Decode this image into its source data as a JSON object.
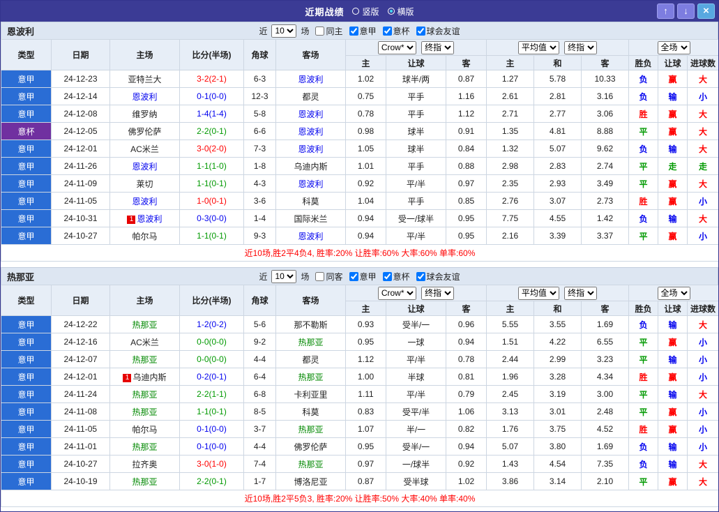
{
  "topbar": {
    "title": "近期战绩",
    "vertical_label": "竖版",
    "horizontal_label": "横版",
    "selected_mode": "横版",
    "up_icon": "↑",
    "down_icon": "↓",
    "close_icon": "×"
  },
  "colors": {
    "red": "#ff0000",
    "green": "#009900",
    "blue": "#0000ee",
    "league_blue": "#2a6dd5",
    "cup_purple": "#7030a0",
    "topbar_bg": "#3b3b95",
    "summary_red": "#ff0000"
  },
  "filters_shared": {
    "near_label": "近",
    "match_count": "10",
    "games_label": "场",
    "venue_checked": false,
    "league_options": [
      "意甲",
      "意杯",
      "球会友谊"
    ],
    "league_checked": [
      true,
      true,
      true
    ]
  },
  "table_head": {
    "type": "类型",
    "date": "日期",
    "home": "主场",
    "score": "比分(半场)",
    "corner": "角球",
    "away": "客场",
    "odds_select": "Crow*",
    "odds_ref_select": "终指",
    "avg_select": "平均值",
    "avg_ref_select": "终指",
    "fulltime_select": "全场",
    "sub_home": "主",
    "sub_handicap": "让球",
    "sub_away": "客",
    "sub_avg_home": "主",
    "sub_draw": "和",
    "sub_avg_away": "客",
    "sub_result": "胜负",
    "sub_hc_result": "让球",
    "sub_goals": "进球数"
  },
  "sections": [
    {
      "team": "恩波利",
      "team_color": "#0000ee",
      "venue_label": "同主",
      "summary": "近10场,胜2平4负4, 胜率:20% 让胜率:60% 大率:60% 单率:60%",
      "rows": [
        {
          "lg": "意甲",
          "d": "24-12-23",
          "h": "亚特兰大",
          "a": "恩波利",
          "af": true,
          "s": "3-2(2-1)",
          "sc": "r",
          "cn": "6-3",
          "o1": "1.02",
          "o2": "球半/两",
          "o3": "0.87",
          "v1": "1.27",
          "v2": "5.78",
          "v3": "10.33",
          "wl": "负",
          "wlc": "b",
          "hc": "赢",
          "hcc": "r",
          "ou": "大",
          "ouc": "r"
        },
        {
          "lg": "意甲",
          "d": "24-12-14",
          "h": "恩波利",
          "hf": true,
          "a": "都灵",
          "s": "0-1(0-0)",
          "sc": "b",
          "cn": "12-3",
          "o1": "0.75",
          "o2": "平手",
          "o3": "1.16",
          "v1": "2.61",
          "v2": "2.81",
          "v3": "3.16",
          "wl": "负",
          "wlc": "b",
          "hc": "输",
          "hcc": "b",
          "ou": "小",
          "ouc": "b"
        },
        {
          "lg": "意甲",
          "d": "24-12-08",
          "h": "维罗纳",
          "a": "恩波利",
          "af": true,
          "s": "1-4(1-4)",
          "sc": "b",
          "cn": "5-8",
          "o1": "0.78",
          "o2": "平手",
          "o3": "1.12",
          "v1": "2.71",
          "v2": "2.77",
          "v3": "3.06",
          "wl": "胜",
          "wlc": "r",
          "hc": "赢",
          "hcc": "r",
          "ou": "大",
          "ouc": "r"
        },
        {
          "lg": "意杯",
          "d": "24-12-05",
          "h": "佛罗伦萨",
          "a": "恩波利",
          "af": true,
          "s": "2-2(0-1)",
          "sc": "g",
          "cn": "6-6",
          "o1": "0.98",
          "o2": "球半",
          "o3": "0.91",
          "v1": "1.35",
          "v2": "4.81",
          "v3": "8.88",
          "wl": "平",
          "wlc": "g",
          "hc": "赢",
          "hcc": "r",
          "ou": "大",
          "ouc": "r"
        },
        {
          "lg": "意甲",
          "d": "24-12-01",
          "h": "AC米兰",
          "a": "恩波利",
          "af": true,
          "s": "3-0(2-0)",
          "sc": "r",
          "cn": "7-3",
          "o1": "1.05",
          "o2": "球半",
          "o3": "0.84",
          "v1": "1.32",
          "v2": "5.07",
          "v3": "9.62",
          "wl": "负",
          "wlc": "b",
          "hc": "输",
          "hcc": "b",
          "ou": "大",
          "ouc": "r"
        },
        {
          "lg": "意甲",
          "d": "24-11-26",
          "h": "恩波利",
          "hf": true,
          "a": "乌迪内斯",
          "s": "1-1(1-0)",
          "sc": "g",
          "cn": "1-8",
          "o1": "1.01",
          "o2": "平手",
          "o3": "0.88",
          "v1": "2.98",
          "v2": "2.83",
          "v3": "2.74",
          "wl": "平",
          "wlc": "g",
          "hc": "走",
          "hcc": "g",
          "ou": "走",
          "ouc": "g"
        },
        {
          "lg": "意甲",
          "d": "24-11-09",
          "h": "莱切",
          "a": "恩波利",
          "af": true,
          "s": "1-1(0-1)",
          "sc": "g",
          "cn": "4-3",
          "o1": "0.92",
          "o2": "平/半",
          "o3": "0.97",
          "v1": "2.35",
          "v2": "2.93",
          "v3": "3.49",
          "wl": "平",
          "wlc": "g",
          "hc": "赢",
          "hcc": "r",
          "ou": "大",
          "ouc": "r"
        },
        {
          "lg": "意甲",
          "d": "24-11-05",
          "h": "恩波利",
          "hf": true,
          "a": "科莫",
          "s": "1-0(0-1)",
          "sc": "r",
          "cn": "3-6",
          "o1": "1.04",
          "o2": "平手",
          "o3": "0.85",
          "v1": "2.76",
          "v2": "3.07",
          "v3": "2.73",
          "wl": "胜",
          "wlc": "r",
          "hc": "赢",
          "hcc": "r",
          "ou": "小",
          "ouc": "b"
        },
        {
          "lg": "意甲",
          "d": "24-10-31",
          "h": "恩波利",
          "hf": true,
          "hb": "1",
          "a": "国际米兰",
          "s": "0-3(0-0)",
          "sc": "b",
          "cn": "1-4",
          "o1": "0.94",
          "o2": "受一/球半",
          "o3": "0.95",
          "v1": "7.75",
          "v2": "4.55",
          "v3": "1.42",
          "wl": "负",
          "wlc": "b",
          "hc": "输",
          "hcc": "b",
          "ou": "大",
          "ouc": "r"
        },
        {
          "lg": "意甲",
          "d": "24-10-27",
          "h": "帕尔马",
          "a": "恩波利",
          "af": true,
          "s": "1-1(0-1)",
          "sc": "g",
          "cn": "9-3",
          "o1": "0.94",
          "o2": "平/半",
          "o3": "0.95",
          "v1": "2.16",
          "v2": "3.39",
          "v3": "3.37",
          "wl": "平",
          "wlc": "g",
          "hc": "赢",
          "hcc": "r",
          "ou": "小",
          "ouc": "b"
        }
      ]
    },
    {
      "team": "热那亚",
      "team_color": "#008800",
      "venue_label": "同客",
      "summary": "近10场,胜2平5负3, 胜率:20% 让胜率:50% 大率:40% 单率:40%",
      "rows": [
        {
          "lg": "意甲",
          "d": "24-12-22",
          "h": "热那亚",
          "hf": true,
          "a": "那不勒斯",
          "s": "1-2(0-2)",
          "sc": "b",
          "cn": "5-6",
          "o1": "0.93",
          "o2": "受半/一",
          "o3": "0.96",
          "v1": "5.55",
          "v2": "3.55",
          "v3": "1.69",
          "wl": "负",
          "wlc": "b",
          "hc": "输",
          "hcc": "b",
          "ou": "大",
          "ouc": "r"
        },
        {
          "lg": "意甲",
          "d": "24-12-16",
          "h": "AC米兰",
          "a": "热那亚",
          "af": true,
          "s": "0-0(0-0)",
          "sc": "g",
          "cn": "9-2",
          "o1": "0.95",
          "o2": "一球",
          "o3": "0.94",
          "v1": "1.51",
          "v2": "4.22",
          "v3": "6.55",
          "wl": "平",
          "wlc": "g",
          "hc": "赢",
          "hcc": "r",
          "ou": "小",
          "ouc": "b"
        },
        {
          "lg": "意甲",
          "d": "24-12-07",
          "h": "热那亚",
          "hf": true,
          "a": "都灵",
          "s": "0-0(0-0)",
          "sc": "g",
          "cn": "4-4",
          "o1": "1.12",
          "o2": "平/半",
          "o3": "0.78",
          "v1": "2.44",
          "v2": "2.99",
          "v3": "3.23",
          "wl": "平",
          "wlc": "g",
          "hc": "输",
          "hcc": "b",
          "ou": "小",
          "ouc": "b"
        },
        {
          "lg": "意甲",
          "d": "24-12-01",
          "h": "乌迪内斯",
          "hb": "1",
          "a": "热那亚",
          "af": true,
          "s": "0-2(0-1)",
          "sc": "b",
          "cn": "6-4",
          "o1": "1.00",
          "o2": "半球",
          "o3": "0.81",
          "v1": "1.96",
          "v2": "3.28",
          "v3": "4.34",
          "wl": "胜",
          "wlc": "r",
          "hc": "赢",
          "hcc": "r",
          "ou": "小",
          "ouc": "b"
        },
        {
          "lg": "意甲",
          "d": "24-11-24",
          "h": "热那亚",
          "hf": true,
          "a": "卡利亚里",
          "s": "2-2(1-1)",
          "sc": "g",
          "cn": "6-8",
          "o1": "1.11",
          "o2": "平/半",
          "o3": "0.79",
          "v1": "2.45",
          "v2": "3.19",
          "v3": "3.00",
          "wl": "平",
          "wlc": "g",
          "hc": "输",
          "hcc": "b",
          "ou": "大",
          "ouc": "r"
        },
        {
          "lg": "意甲",
          "d": "24-11-08",
          "h": "热那亚",
          "hf": true,
          "a": "科莫",
          "s": "1-1(0-1)",
          "sc": "g",
          "cn": "8-5",
          "o1": "0.83",
          "o2": "受平/半",
          "o3": "1.06",
          "v1": "3.13",
          "v2": "3.01",
          "v3": "2.48",
          "wl": "平",
          "wlc": "g",
          "hc": "赢",
          "hcc": "r",
          "ou": "小",
          "ouc": "b"
        },
        {
          "lg": "意甲",
          "d": "24-11-05",
          "h": "帕尔马",
          "a": "热那亚",
          "af": true,
          "s": "0-1(0-0)",
          "sc": "b",
          "cn": "3-7",
          "o1": "1.07",
          "o2": "半/一",
          "o3": "0.82",
          "v1": "1.76",
          "v2": "3.75",
          "v3": "4.52",
          "wl": "胜",
          "wlc": "r",
          "hc": "赢",
          "hcc": "r",
          "ou": "小",
          "ouc": "b"
        },
        {
          "lg": "意甲",
          "d": "24-11-01",
          "h": "热那亚",
          "hf": true,
          "a": "佛罗伦萨",
          "s": "0-1(0-0)",
          "sc": "b",
          "cn": "4-4",
          "o1": "0.95",
          "o2": "受半/一",
          "o3": "0.94",
          "v1": "5.07",
          "v2": "3.80",
          "v3": "1.69",
          "wl": "负",
          "wlc": "b",
          "hc": "输",
          "hcc": "b",
          "ou": "小",
          "ouc": "b"
        },
        {
          "lg": "意甲",
          "d": "24-10-27",
          "h": "拉齐奥",
          "a": "热那亚",
          "af": true,
          "s": "3-0(1-0)",
          "sc": "r",
          "cn": "7-4",
          "o1": "0.97",
          "o2": "一/球半",
          "o3": "0.92",
          "v1": "1.43",
          "v2": "4.54",
          "v3": "7.35",
          "wl": "负",
          "wlc": "b",
          "hc": "输",
          "hcc": "b",
          "ou": "大",
          "ouc": "r"
        },
        {
          "lg": "意甲",
          "d": "24-10-19",
          "h": "热那亚",
          "hf": true,
          "a": "博洛尼亚",
          "s": "2-2(0-1)",
          "sc": "g",
          "cn": "1-7",
          "o1": "0.87",
          "o2": "受半球",
          "o3": "1.02",
          "v1": "3.86",
          "v2": "3.14",
          "v3": "2.10",
          "wl": "平",
          "wlc": "g",
          "hc": "赢",
          "hcc": "r",
          "ou": "大",
          "ouc": "r"
        }
      ]
    }
  ]
}
